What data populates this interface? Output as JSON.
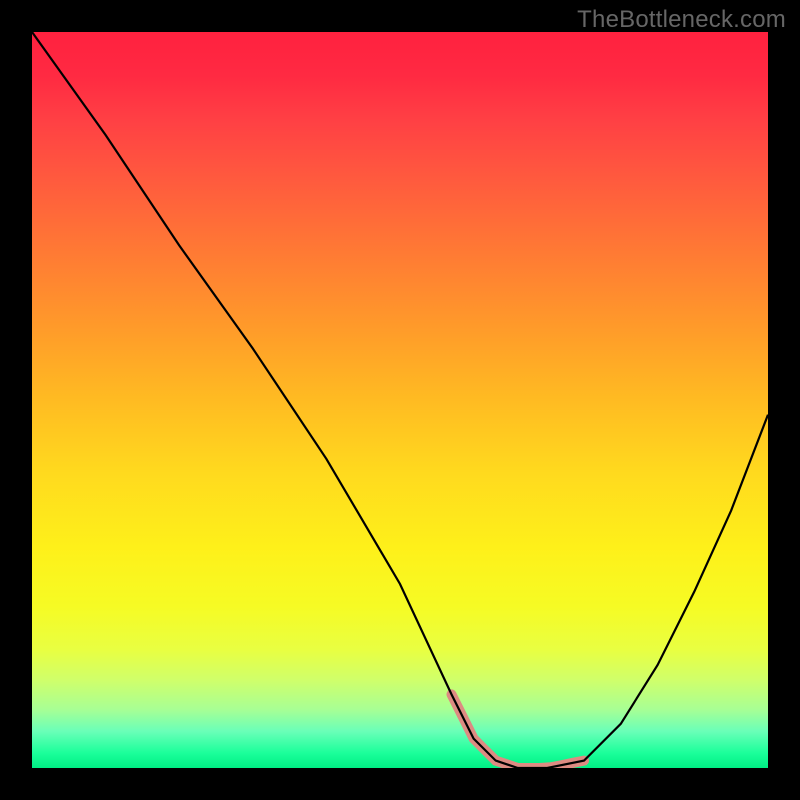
{
  "watermark": "TheBottleneck.com",
  "chart_data": {
    "type": "line",
    "title": "",
    "xlabel": "",
    "ylabel": "",
    "xlim": [
      0,
      100
    ],
    "ylim": [
      0,
      100
    ],
    "series": [
      {
        "name": "curve",
        "x": [
          0,
          10,
          20,
          30,
          40,
          50,
          57,
          60,
          63,
          66,
          70,
          75,
          80,
          85,
          90,
          95,
          100
        ],
        "values": [
          100,
          86,
          71,
          57,
          42,
          25,
          10,
          4,
          1,
          0,
          0,
          1,
          6,
          14,
          24,
          35,
          48
        ]
      }
    ],
    "flat_segment": {
      "x_start": 57,
      "x_end": 75,
      "color": "#dd8b82",
      "thickness": 10
    },
    "gradient_stops": [
      {
        "pos": 0.0,
        "color": "#ff213f"
      },
      {
        "pos": 0.5,
        "color": "#ffbb22"
      },
      {
        "pos": 0.8,
        "color": "#f6fb24"
      },
      {
        "pos": 1.0,
        "color": "#00ee84"
      }
    ]
  }
}
